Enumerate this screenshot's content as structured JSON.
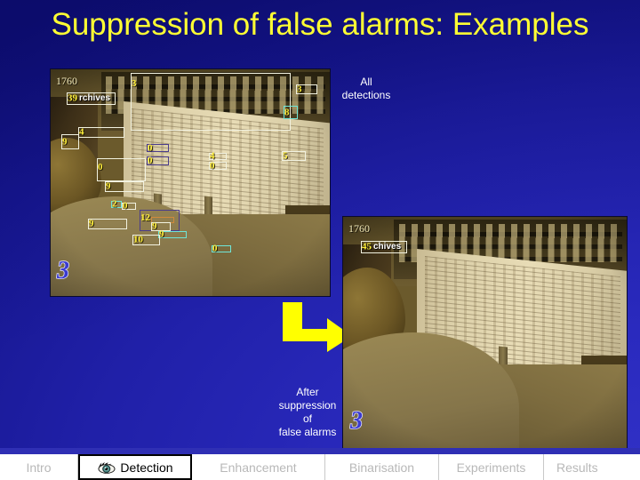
{
  "slide": {
    "title": "Suppression of false alarms: Examples",
    "title_color": "#ffff33",
    "background_color": "#2424b4"
  },
  "captions": {
    "all_detections": "All\ndetections",
    "after_suppression": "After\nsuppression\nof\nfalse alarms"
  },
  "arrow": {
    "name": "elbow-arrow",
    "color": "#ffff00",
    "direction": "down-then-right"
  },
  "frames": {
    "main": {
      "caption_ref": "All detections",
      "timestamp": "1760",
      "channel_logo": "3",
      "detections": [
        {
          "label": "39",
          "text": "rchives"
        },
        {
          "label": "3",
          "text": ""
        },
        {
          "label": "3",
          "text": ""
        },
        {
          "label": "8",
          "text": ""
        },
        {
          "label": "9",
          "text": ""
        },
        {
          "label": "4",
          "text": ""
        },
        {
          "label": "0",
          "text": ""
        },
        {
          "label": "0",
          "text": ""
        },
        {
          "label": "0",
          "text": ""
        },
        {
          "label": "9",
          "text": ""
        },
        {
          "label": "4",
          "text": ""
        },
        {
          "label": "0",
          "text": ""
        },
        {
          "label": "5",
          "text": ""
        },
        {
          "label": "2",
          "text": ""
        },
        {
          "label": "0",
          "text": ""
        },
        {
          "label": "12",
          "text": ""
        },
        {
          "label": "9",
          "text": ""
        },
        {
          "label": "9",
          "text": ""
        },
        {
          "label": "9",
          "text": ""
        },
        {
          "label": "10",
          "text": ""
        },
        {
          "label": "0",
          "text": ""
        }
      ]
    },
    "after": {
      "caption_ref": "After suppression of false alarms",
      "timestamp": "1760",
      "channel_logo": "3",
      "detections": [
        {
          "label": "45",
          "text": "chives"
        }
      ]
    }
  },
  "navbar": {
    "tabs": [
      {
        "label": "Intro",
        "active": false,
        "icon": ""
      },
      {
        "label": "Detection",
        "active": true,
        "icon": "eye-icon"
      },
      {
        "label": "Enhancement",
        "active": false,
        "icon": ""
      },
      {
        "label": "Binarisation",
        "active": false,
        "icon": ""
      },
      {
        "label": "Experiments",
        "active": false,
        "icon": ""
      },
      {
        "label": "Results",
        "active": false,
        "icon": ""
      }
    ]
  }
}
